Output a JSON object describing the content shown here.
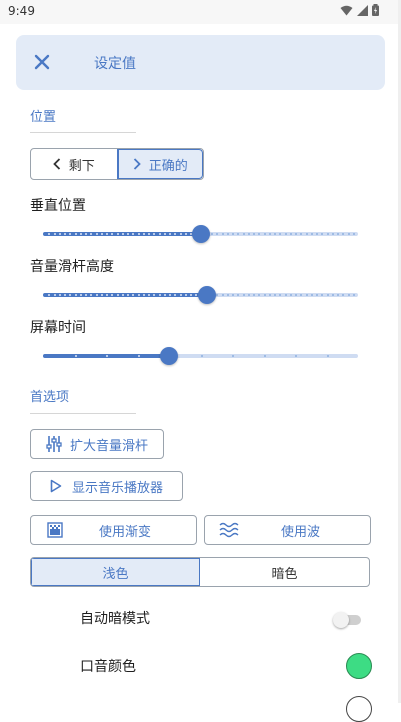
{
  "status_bar": {
    "time": "9:49"
  },
  "header": {
    "title": "设定值",
    "close_icon": "close-icon"
  },
  "sections": {
    "position": "位置",
    "preferences": "首选项"
  },
  "position_toggle": {
    "left_label": "剩下",
    "right_label": "正确的",
    "selected": "right"
  },
  "sliders": [
    {
      "label": "垂直位置",
      "value": 0.5,
      "style": "dotted"
    },
    {
      "label": "音量滑杆高度",
      "value": 0.52,
      "style": "dotted"
    },
    {
      "label": "屏幕时间",
      "value": 0.4,
      "style": "sparse"
    }
  ],
  "buttons": {
    "expand_slider": "扩大音量滑杆",
    "show_player": "显示音乐播放器",
    "use_gradient": "使用渐变",
    "use_wave": "使用波"
  },
  "theme": {
    "light": "浅色",
    "dark": "暗色",
    "selected": "light"
  },
  "rows": {
    "auto_dark": "自动暗模式",
    "accent_color": "口音颜色"
  },
  "colors": {
    "accent": "#4a78c4",
    "header_bg": "#e3ebf7",
    "swatch": "#3ddc84"
  }
}
